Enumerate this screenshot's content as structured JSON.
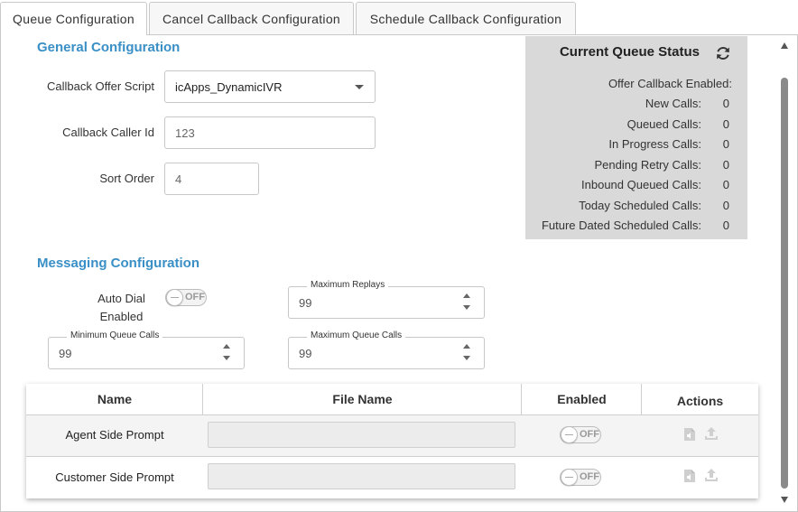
{
  "tabs": [
    {
      "label": "Queue Configuration"
    },
    {
      "label": "Cancel Callback Configuration"
    },
    {
      "label": "Schedule Callback Configuration"
    }
  ],
  "general": {
    "title": "General Configuration",
    "callback_offer_script_label": "Callback Offer Script",
    "callback_offer_script_value": "icApps_DynamicIVR",
    "callback_caller_id_label": "Callback Caller Id",
    "callback_caller_id_value": "123",
    "sort_order_label": "Sort Order",
    "sort_order_value": "4"
  },
  "status": {
    "title": "Current Queue Status",
    "rows": [
      {
        "label": "Offer Callback Enabled:",
        "value": ""
      },
      {
        "label": "New Calls:",
        "value": "0"
      },
      {
        "label": "Queued Calls:",
        "value": "0"
      },
      {
        "label": "In Progress Calls:",
        "value": "0"
      },
      {
        "label": "Pending Retry Calls:",
        "value": "0"
      },
      {
        "label": "Inbound Queued Calls:",
        "value": "0"
      },
      {
        "label": "Today Scheduled Calls:",
        "value": "0"
      },
      {
        "label": "Future Dated Scheduled Calls:",
        "value": "0"
      }
    ]
  },
  "messaging": {
    "title": "Messaging Configuration",
    "auto_dial_label_1": "Auto Dial",
    "auto_dial_label_2": "Enabled",
    "auto_dial_state": "OFF",
    "max_replays_label": "Maximum Replays",
    "max_replays_value": "99",
    "min_queue_calls_label": "Minimum Queue Calls",
    "min_queue_calls_value": "99",
    "max_queue_calls_label": "Maximum Queue Calls",
    "max_queue_calls_value": "99"
  },
  "prompts_table": {
    "headers": {
      "name": "Name",
      "file_name": "File Name",
      "enabled": "Enabled",
      "actions": "Actions"
    },
    "rows": [
      {
        "name": "Agent Side Prompt",
        "file_name": "",
        "enabled": "OFF"
      },
      {
        "name": "Customer Side Prompt",
        "file_name": "",
        "enabled": "OFF"
      }
    ]
  },
  "colors": {
    "accent": "#3a8fc6",
    "status_bg": "#d9d9d9"
  },
  "icons": [
    "refresh-icon",
    "file-audio-icon",
    "upload-icon"
  ]
}
